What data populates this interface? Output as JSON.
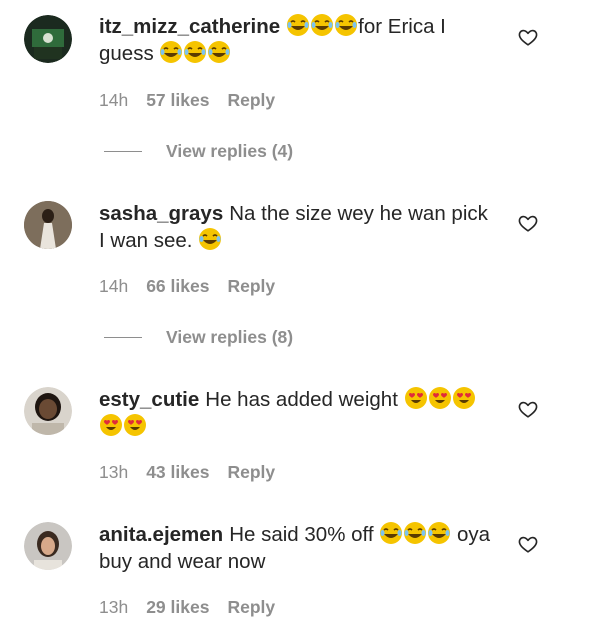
{
  "comments": [
    {
      "username": "itz_mizz_catherine",
      "parts": [
        "",
        "for Erica I guess"
      ],
      "emoji_a": [
        "laugh-cry-emoji",
        "laugh-cry-emoji",
        "laugh-cry-emoji"
      ],
      "emoji_b": [
        "laugh-cry-emoji",
        "laugh-cry-emoji",
        "laugh-cry-emoji"
      ],
      "time": "14h",
      "likes": "57 likes",
      "reply": "Reply",
      "view_replies": "View replies (4)"
    },
    {
      "username": "sasha_grays",
      "text": "Na the size wey he wan pick I wan see.",
      "emoji_b": [
        "laugh-cry-emoji"
      ],
      "time": "14h",
      "likes": "66 likes",
      "reply": "Reply",
      "view_replies": "View replies (8)"
    },
    {
      "username": "esty_cutie",
      "text": "He has added weight",
      "emoji_b": [
        "heart-eyes-emoji",
        "heart-eyes-emoji",
        "heart-eyes-emoji",
        "heart-eyes-emoji",
        "heart-eyes-emoji"
      ],
      "time": "13h",
      "likes": "43 likes",
      "reply": "Reply"
    },
    {
      "username": "anita.ejemen",
      "text_a": "He said 30% off",
      "text_b": "oya buy and wear now",
      "emoji_a": [
        "laugh-cry-emoji",
        "laugh-cry-emoji",
        "laugh-cry-emoji"
      ],
      "time": "13h",
      "likes": "29 likes",
      "reply": "Reply"
    }
  ],
  "icons": {
    "like": "heart-outline-icon"
  },
  "colors": {
    "text": "#262626",
    "meta": "#8e8e8e",
    "emoji": "#f5c400"
  }
}
